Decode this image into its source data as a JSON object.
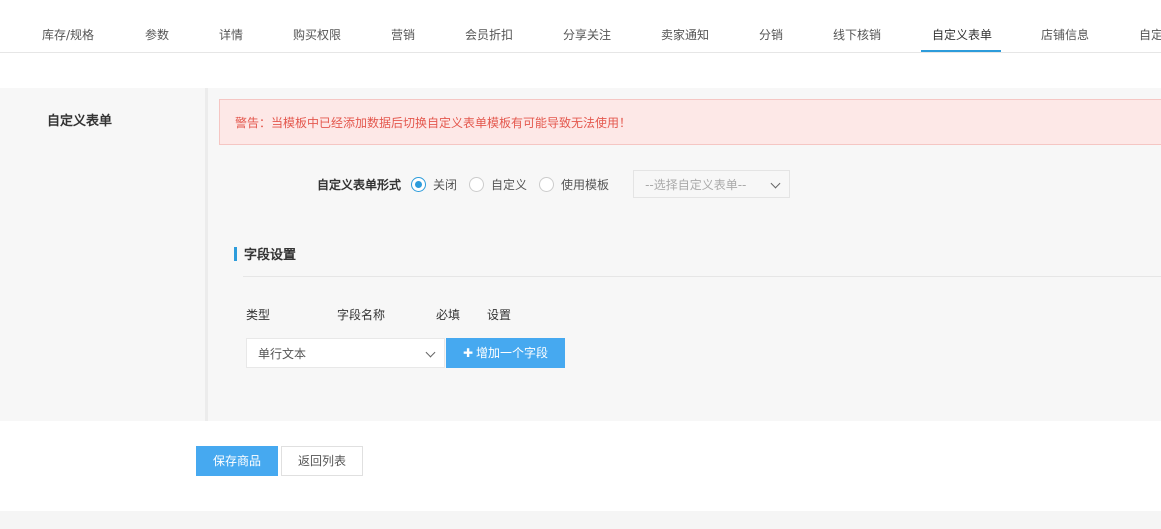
{
  "tabs": [
    {
      "label": "库存/规格",
      "active": false
    },
    {
      "label": "参数",
      "active": false
    },
    {
      "label": "详情",
      "active": false
    },
    {
      "label": "购买权限",
      "active": false
    },
    {
      "label": "营销",
      "active": false
    },
    {
      "label": "会员折扣",
      "active": false
    },
    {
      "label": "分享关注",
      "active": false
    },
    {
      "label": "卖家通知",
      "active": false
    },
    {
      "label": "分销",
      "active": false
    },
    {
      "label": "线下核销",
      "active": false
    },
    {
      "label": "自定义表单",
      "active": true
    },
    {
      "label": "店铺信息",
      "active": false
    },
    {
      "label": "自定",
      "active": false
    }
  ],
  "section": {
    "title": "自定义表单",
    "warning": "警告：当模板中已经添加数据后切换自定义表单模板有可能导致无法使用！",
    "form_mode": {
      "label": "自定义表单形式",
      "options": [
        {
          "label": "关闭",
          "checked": true
        },
        {
          "label": "自定义",
          "checked": false
        },
        {
          "label": "使用模板",
          "checked": false
        }
      ],
      "template_select_value": "--选择自定义表单--"
    },
    "fields": {
      "title": "字段设置",
      "columns": [
        "类型",
        "字段名称",
        "必填",
        "设置"
      ],
      "type_select_value": "单行文本",
      "add_button_label": "增加一个字段"
    }
  },
  "actions": {
    "save_label": "保存商品",
    "back_label": "返回列表"
  },
  "colors": {
    "accent": "#46a9f0",
    "tab_underline": "#2d9cdb",
    "warning_text": "#e4584e",
    "warning_bg": "#fde8e7"
  }
}
